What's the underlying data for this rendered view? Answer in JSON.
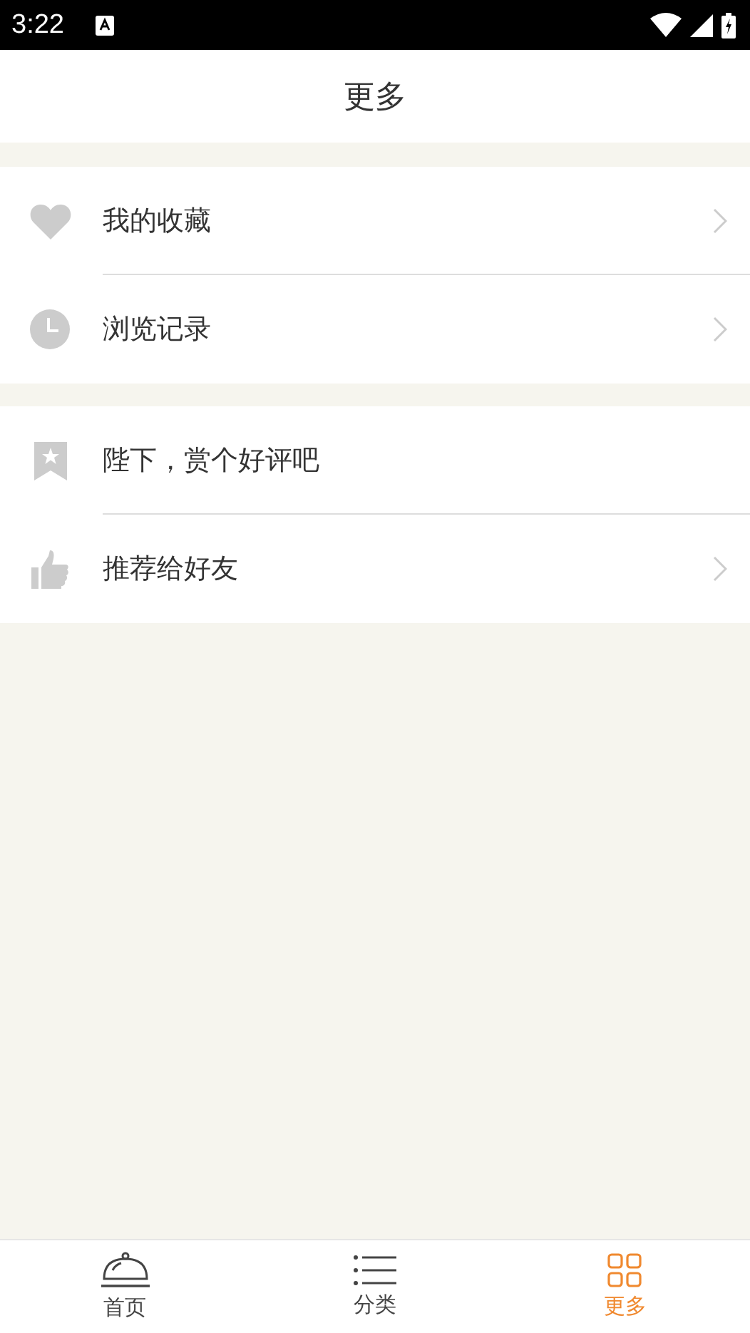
{
  "status_bar": {
    "time": "3:22"
  },
  "header": {
    "title": "更多"
  },
  "groups": [
    {
      "items": [
        {
          "label": "我的收藏",
          "has_arrow": true
        },
        {
          "label": "浏览记录",
          "has_arrow": true
        }
      ]
    },
    {
      "items": [
        {
          "label": "陛下，赏个好评吧",
          "has_arrow": false
        },
        {
          "label": "推荐给好友",
          "has_arrow": true
        }
      ]
    }
  ],
  "tabs": [
    {
      "label": "首页",
      "selected": false
    },
    {
      "label": "分类",
      "selected": false
    },
    {
      "label": "更多",
      "selected": true
    }
  ]
}
